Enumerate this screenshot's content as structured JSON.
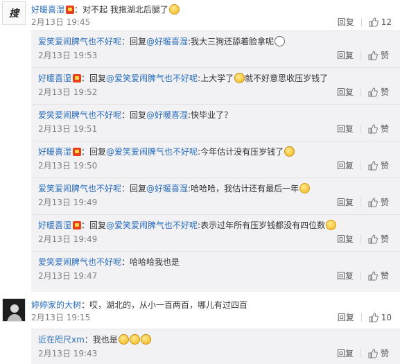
{
  "comments": [
    {
      "user": "好暖喜湿",
      "text": "：对不起  我拖湖北后腿了",
      "time": "2月13日 19:45",
      "reply_label": "回复",
      "likes": "12",
      "avatar_glyph": "搜"
    },
    {
      "user": "婷婷家的大树",
      "text": "：哎，湖北的，从小一百两百，哪儿有过四百",
      "time": "2月13日 19:15",
      "reply_label": "回复",
      "likes": "10"
    }
  ],
  "replies_1": [
    {
      "user": "爱笑爱闹脾气也不好呢",
      "prefix": "：回复",
      "mention": "@好暖喜湿",
      "text": ":我大三狗还舔着脸拿呢",
      "time": "2月13日 19:53",
      "reply_label": "回复",
      "like_label": "赞"
    },
    {
      "user": "好暖喜湿",
      "prefix": "：回复",
      "mention": "@爱笑爱闹脾气也不好呢",
      "text": ":上大学了",
      "text2": "就不好意思收压岁钱了",
      "time": "2月13日 19:52",
      "reply_label": "回复",
      "like_label": "赞"
    },
    {
      "user": "爱笑爱闹脾气也不好呢",
      "prefix": "：回复",
      "mention": "@好暖喜湿",
      "text": ":快毕业了？",
      "time": "2月13日 19:51",
      "reply_label": "回复",
      "like_label": "赞"
    },
    {
      "user": "好暖喜湿",
      "prefix": "：回复",
      "mention": "@爱笑爱闹脾气也不好呢",
      "text": ":今年估计没有压岁钱了",
      "time": "2月13日 19:50",
      "reply_label": "回复",
      "like_label": "赞"
    },
    {
      "user": "爱笑爱闹脾气也不好呢",
      "prefix": "：回复",
      "mention": "@好暖喜湿",
      "text": ":哈哈哈，我估计还有最后一年",
      "time": "2月13日 19:49",
      "reply_label": "回复",
      "like_label": "赞"
    },
    {
      "user": "好暖喜湿",
      "prefix": "：回复",
      "mention": "@爱笑爱闹脾气也不好呢",
      "text": ":表示过年所有压岁钱都没有四位数",
      "time": "2月13日 19:49",
      "reply_label": "回复",
      "like_label": "赞"
    },
    {
      "user": "爱笑爱闹脾气也不好呢",
      "prefix": "",
      "mention": "",
      "text": "：哈哈哈我也是",
      "time": "2月13日 19:47",
      "reply_label": "回复",
      "like_label": "赞"
    }
  ],
  "replies_2": [
    {
      "user": "近在咫尺xm",
      "text": "：我也是",
      "time": "2月13日 19:43",
      "reply_label": "回复",
      "like_label": "赞"
    }
  ]
}
